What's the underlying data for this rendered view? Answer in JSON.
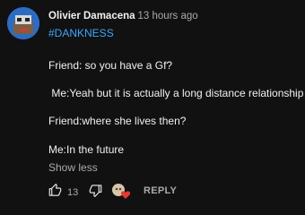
{
  "comment": {
    "author": "Olivier Damacena",
    "time": "13 hours ago",
    "hashtag": "#DANKNESS",
    "lines": [
      "Friend: so you have a Gf?",
      " Me:Yeah but it is actually a long distance relationship",
      "Friend:where she lives then?",
      "Me:In the future"
    ],
    "show_less": "Show less",
    "like_count": "13",
    "reply_label": "REPLY"
  },
  "icons": {
    "like": "thumb-up-icon",
    "dislike": "thumb-down-icon",
    "creator_heart": "creator-heart-icon"
  },
  "colors": {
    "background": "#111111",
    "text": "#f1f1f1",
    "secondary_text": "#aaaaaa",
    "hashtag": "#3ea6ff",
    "heart": "#e53935"
  }
}
